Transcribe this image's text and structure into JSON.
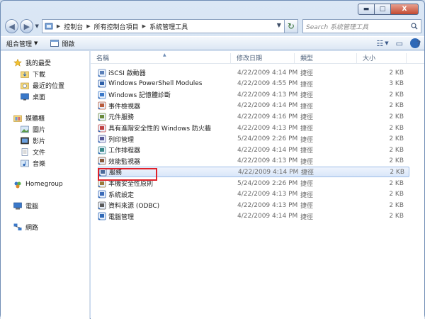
{
  "window": {
    "min_label": "▬",
    "max_label": "□",
    "close_label": "X"
  },
  "nav": {
    "breadcrumbs": [
      "控制台",
      "所有控制台項目",
      "系統管理工具"
    ],
    "search_placeholder": "Search 系統管理工具"
  },
  "toolbar": {
    "organize_label": "組合管理",
    "open_label": "開啟",
    "help_label": "?"
  },
  "sidebar": {
    "favorites": {
      "label": "我的最愛",
      "icon": "star-icon"
    },
    "favorite_items": [
      {
        "label": "下載",
        "icon": "download-folder-icon"
      },
      {
        "label": "最近的位置",
        "icon": "recent-places-icon"
      },
      {
        "label": "桌面",
        "icon": "desktop-icon"
      }
    ],
    "libraries": {
      "label": "媒體櫃",
      "icon": "library-icon"
    },
    "library_items": [
      {
        "label": "圖片",
        "icon": "pictures-icon"
      },
      {
        "label": "影片",
        "icon": "videos-icon"
      },
      {
        "label": "文件",
        "icon": "documents-icon"
      },
      {
        "label": "音樂",
        "icon": "music-icon"
      }
    ],
    "homegroup": {
      "label": "Homegroup",
      "icon": "homegroup-icon"
    },
    "computer": {
      "label": "電腦",
      "icon": "computer-icon"
    },
    "network": {
      "label": "網路",
      "icon": "network-icon"
    }
  },
  "columns": {
    "name": "名稱",
    "date": "修改日期",
    "type": "類型",
    "size": "大小"
  },
  "files": [
    {
      "name": "iSCSI 啟動器",
      "date": "4/22/2009 4:14 PM",
      "type": "捷徑",
      "size": "2 KB"
    },
    {
      "name": "Windows PowerShell Modules",
      "date": "4/22/2009 4:55 PM",
      "type": "捷徑",
      "size": "3 KB"
    },
    {
      "name": "Windows 記憶體診斷",
      "date": "4/22/2009 4:13 PM",
      "type": "捷徑",
      "size": "2 KB"
    },
    {
      "name": "事件檢視器",
      "date": "4/22/2009 4:14 PM",
      "type": "捷徑",
      "size": "2 KB"
    },
    {
      "name": "元件服務",
      "date": "4/22/2009 4:16 PM",
      "type": "捷徑",
      "size": "2 KB"
    },
    {
      "name": "具有進階安全性的 Windows 防火牆",
      "date": "4/22/2009 4:13 PM",
      "type": "捷徑",
      "size": "2 KB"
    },
    {
      "name": "列印管理",
      "date": "5/24/2009 2:26 PM",
      "type": "捷徑",
      "size": "2 KB"
    },
    {
      "name": "工作排程器",
      "date": "4/22/2009 4:14 PM",
      "type": "捷徑",
      "size": "2 KB"
    },
    {
      "name": "效能監視器",
      "date": "4/22/2009 4:13 PM",
      "type": "捷徑",
      "size": "2 KB"
    },
    {
      "name": "服務",
      "date": "4/22/2009 4:14 PM",
      "type": "捷徑",
      "size": "2 KB"
    },
    {
      "name": "本機安全性原則",
      "date": "5/24/2009 2:26 PM",
      "type": "捷徑",
      "size": "2 KB"
    },
    {
      "name": "系統設定",
      "date": "4/22/2009 4:13 PM",
      "type": "捷徑",
      "size": "2 KB"
    },
    {
      "name": "資料來源 (ODBC)",
      "date": "4/22/2009 4:13 PM",
      "type": "捷徑",
      "size": "2 KB"
    },
    {
      "name": "電腦管理",
      "date": "4/22/2009 4:14 PM",
      "type": "捷徑",
      "size": "2 KB"
    }
  ],
  "selected_index": 9,
  "colors": {
    "selection_border": "#9dbde8",
    "highlight_box": "#e0212a"
  }
}
